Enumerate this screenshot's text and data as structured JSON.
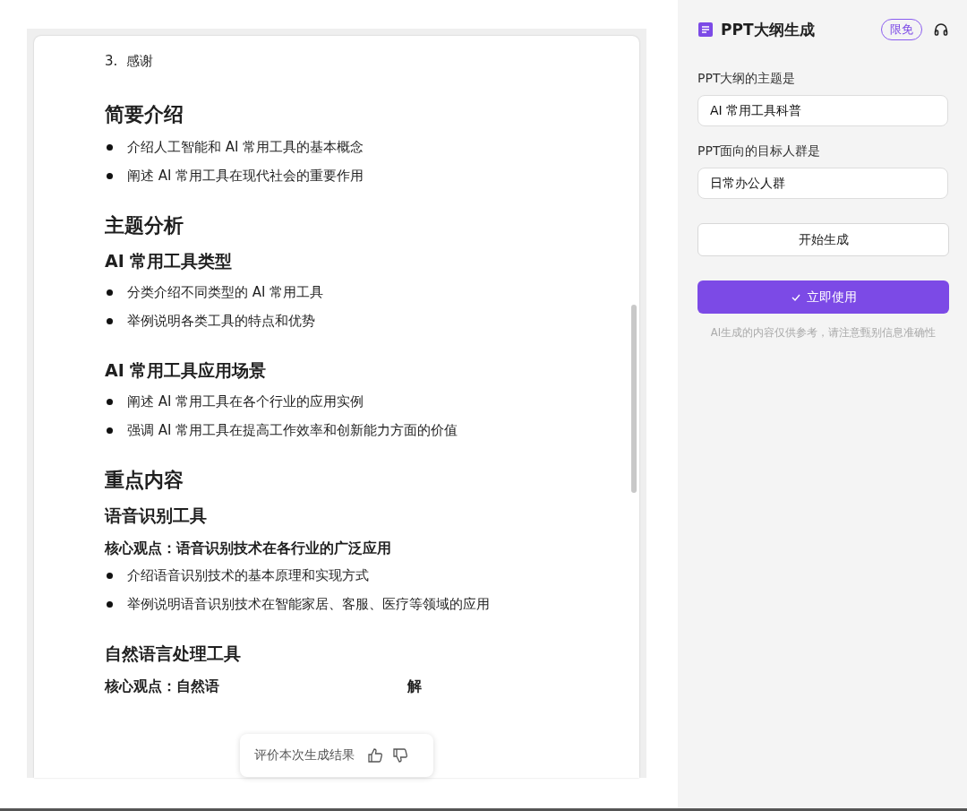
{
  "document": {
    "blocks": [
      {
        "kind": "numbered",
        "number": "3.",
        "text": "感谢"
      },
      {
        "kind": "h2",
        "text": "简要介绍"
      },
      {
        "kind": "bullet",
        "text": "介绍人工智能和 AI 常用工具的基本概念"
      },
      {
        "kind": "bullet",
        "text": "阐述 AI 常用工具在现代社会的重要作用"
      },
      {
        "kind": "h2",
        "text": "主题分析"
      },
      {
        "kind": "h3",
        "text": "AI 常用工具类型"
      },
      {
        "kind": "bullet",
        "text": "分类介绍不同类型的 AI 常用工具"
      },
      {
        "kind": "bullet",
        "text": "举例说明各类工具的特点和优势"
      },
      {
        "kind": "h3",
        "text": "AI 常用工具应用场景"
      },
      {
        "kind": "bullet",
        "text": "阐述 AI 常用工具在各个行业的应用实例"
      },
      {
        "kind": "bullet",
        "text": "强调 AI 常用工具在提高工作效率和创新能力方面的价值"
      },
      {
        "kind": "h2",
        "text": "重点内容"
      },
      {
        "kind": "h3",
        "text": "语音识别工具"
      },
      {
        "kind": "h4",
        "text": "核心观点：语音识别技术在各行业的广泛应用"
      },
      {
        "kind": "bullet",
        "text": "介绍语音识别技术的基本原理和实现方式"
      },
      {
        "kind": "bullet",
        "text": "举例说明语音识别技术在智能家居、客服、医疗等领域的应用"
      },
      {
        "kind": "h3",
        "text": "自然语言处理工具"
      },
      {
        "kind": "h4",
        "text": "核心观点：自然语",
        "text_after": "解"
      }
    ]
  },
  "feedback": {
    "label": "评价本次生成结果"
  },
  "panel": {
    "title": "PPT大纲生成",
    "badge": "限免",
    "fields": [
      {
        "label": "PPT大纲的主题是",
        "value": "AI 常用工具科普"
      },
      {
        "label": "PPT面向的目标人群是",
        "value": "日常办公人群"
      }
    ],
    "generate_button": "开始生成",
    "use_button": "立即使用",
    "disclaimer": "AI生成的内容仅供参考，请注意甄别信息准确性"
  }
}
